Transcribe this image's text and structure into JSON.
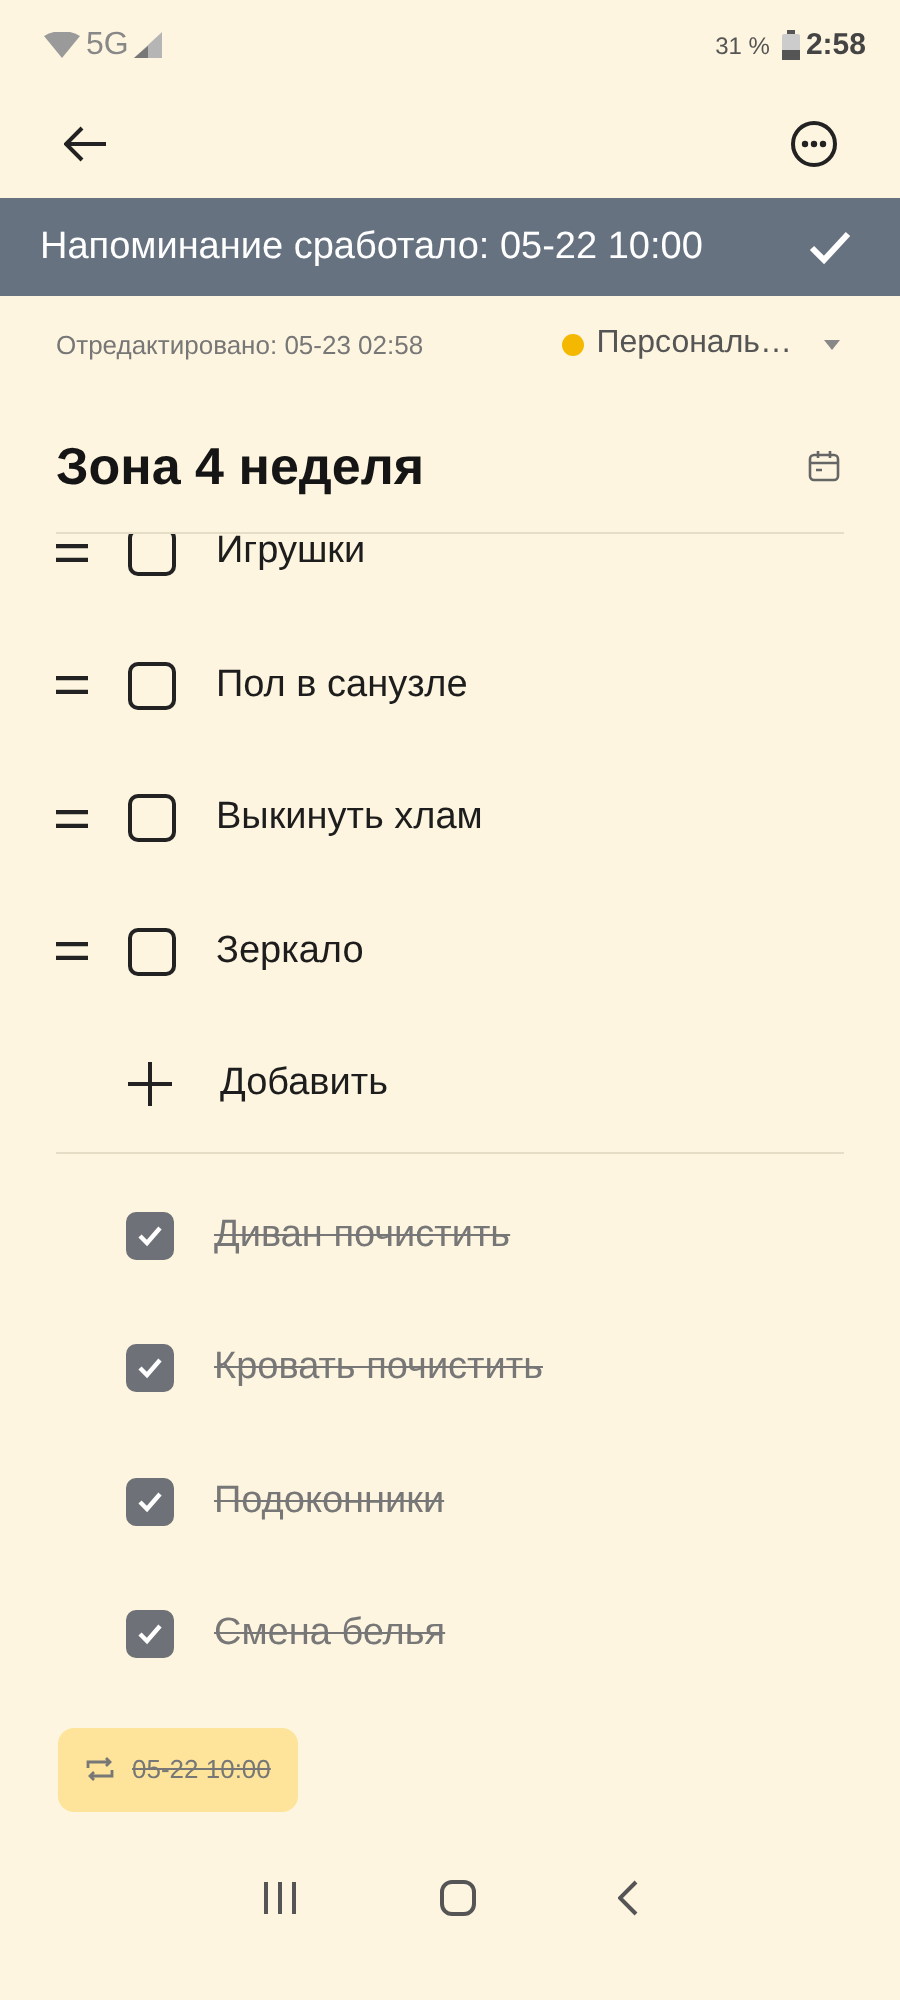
{
  "status_bar": {
    "network": "5G",
    "battery": "31 %",
    "time": "2:58"
  },
  "banner": {
    "text": "Напоминание сработало: 05-22 10:00"
  },
  "meta": {
    "edited": "Отредактировано: 05-23 02:58",
    "category": {
      "label": "Персональ…",
      "color": "#f5b800"
    }
  },
  "title": "Зона 4 неделя",
  "items": [
    {
      "text": "Игрушки",
      "checked": false
    },
    {
      "text": "Пол в санузле",
      "checked": false
    },
    {
      "text": "Выкинуть хлам",
      "checked": false
    },
    {
      "text": "Зеркало",
      "checked": false
    }
  ],
  "add_label": "Добавить",
  "done_items": [
    {
      "text": "Диван почистить",
      "checked": true
    },
    {
      "text": "Кровать почистить",
      "checked": true
    },
    {
      "text": "Подоконники",
      "checked": true
    },
    {
      "text": "Смена белья",
      "checked": true
    }
  ],
  "reminder_chip": {
    "text": "05-22 10:00"
  }
}
